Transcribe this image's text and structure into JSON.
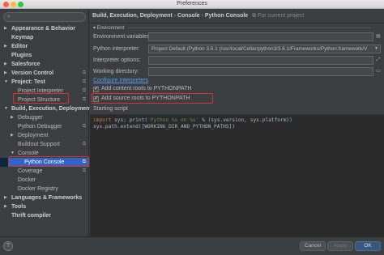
{
  "window": {
    "title": "Preferences"
  },
  "sidebar": {
    "search_placeholder": "",
    "items": [
      {
        "label": "Appearance & Behavior"
      },
      {
        "label": "Keymap"
      },
      {
        "label": "Editor"
      },
      {
        "label": "Plugins"
      },
      {
        "label": "Salesforce"
      },
      {
        "label": "Version Control"
      },
      {
        "label": "Project: Test"
      },
      {
        "label": "Project Interpreter"
      },
      {
        "label": "Project Structure"
      },
      {
        "label": "Build, Execution, Deployment"
      },
      {
        "label": "Debugger"
      },
      {
        "label": "Python Debugger"
      },
      {
        "label": "Deployment"
      },
      {
        "label": "Buildout Support"
      },
      {
        "label": "Console"
      },
      {
        "label": "Python Console"
      },
      {
        "label": "Coverage"
      },
      {
        "label": "Docker"
      },
      {
        "label": "Docker Registry"
      },
      {
        "label": "Languages & Frameworks"
      },
      {
        "label": "Tools"
      },
      {
        "label": "Thrift compiler"
      }
    ],
    "selected": "Python Console"
  },
  "breadcrumb": {
    "part1": "Build, Execution, Deployment",
    "sep": "›",
    "part2": "Console",
    "part3": "Python Console",
    "scope": "For current project"
  },
  "environment": {
    "section_label": "Environment",
    "env_vars_label": "Environment variables:",
    "env_vars_value": "",
    "interpreter_label": "Python interpreter:",
    "interpreter_value": "Project Default (Python 3.6.1 (/usr/local/Cellar/python3/3.6.1/Frameworks/Python.framework/V",
    "interpreter_options_label": "Interpreter options:",
    "interpreter_options_value": "",
    "working_dir_label": "Working directory:",
    "working_dir_value": "",
    "configure_link": "Configure Interpreters",
    "add_content_roots": "Add content roots to PYTHONPATH",
    "add_source_roots": "Add source roots to PYTHONPATH"
  },
  "starting_script": {
    "label": "Starting script",
    "line1_kw": "import",
    "line1_a": " sys; print(",
    "line1_str": "'Python %s on %s'",
    "line1_b": " % (sys.version, sys.platform))",
    "line2": "sys.path.extend([WORKING_DIR_AND_PYTHON_PATHS])"
  },
  "footer": {
    "help_label": "?",
    "cancel": "Cancel",
    "apply": "Apply",
    "ok": "OK"
  },
  "colors": {
    "selection": "#2f65ca",
    "highlight_box": "#e0302a",
    "link": "#589df6",
    "keyword": "#cc7832",
    "string": "#6a8759"
  }
}
